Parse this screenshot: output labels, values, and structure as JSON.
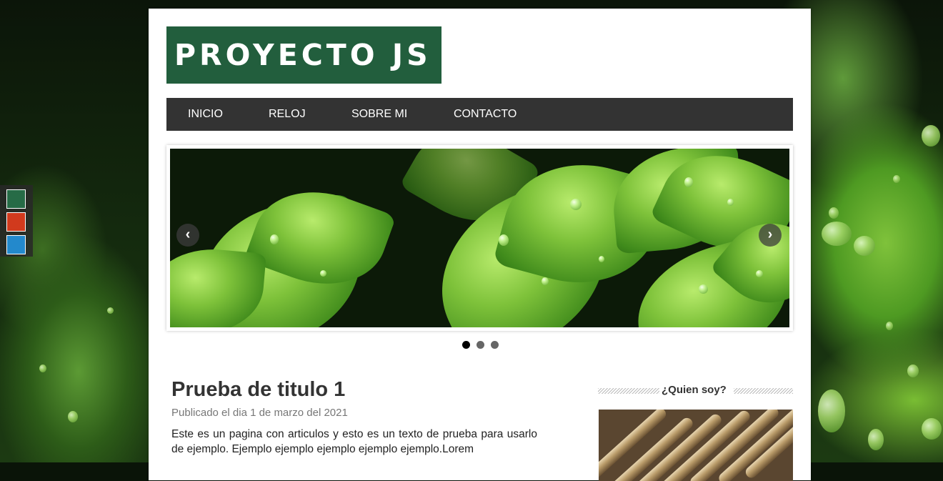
{
  "colors": {
    "brand": "#225e3d",
    "menu_bg": "#333333",
    "swatch_green": "#266b46",
    "swatch_red": "#d13a1d",
    "swatch_blue": "#2389cc"
  },
  "theme_swatches": [
    "green",
    "red",
    "blue"
  ],
  "header": {
    "logo_text": "PROYECTO JS"
  },
  "menu": {
    "items": [
      "INICIO",
      "RELOJ",
      "SOBRE MI",
      "CONTACTO"
    ]
  },
  "slider": {
    "prev_icon": "chevron-left-icon",
    "next_icon": "chevron-right-icon",
    "slide_count": 3,
    "active_index": 0
  },
  "article": {
    "title": "Prueba de titulo 1",
    "date": "Publicado el dia 1 de marzo del 2021",
    "body": "Este es un pagina con articulos y esto es un texto de prueba para usarlo de ejemplo. Ejemplo ejemplo ejemplo ejemplo ejemplo.Lorem"
  },
  "sidebar": {
    "heading": "¿Quien soy?"
  }
}
